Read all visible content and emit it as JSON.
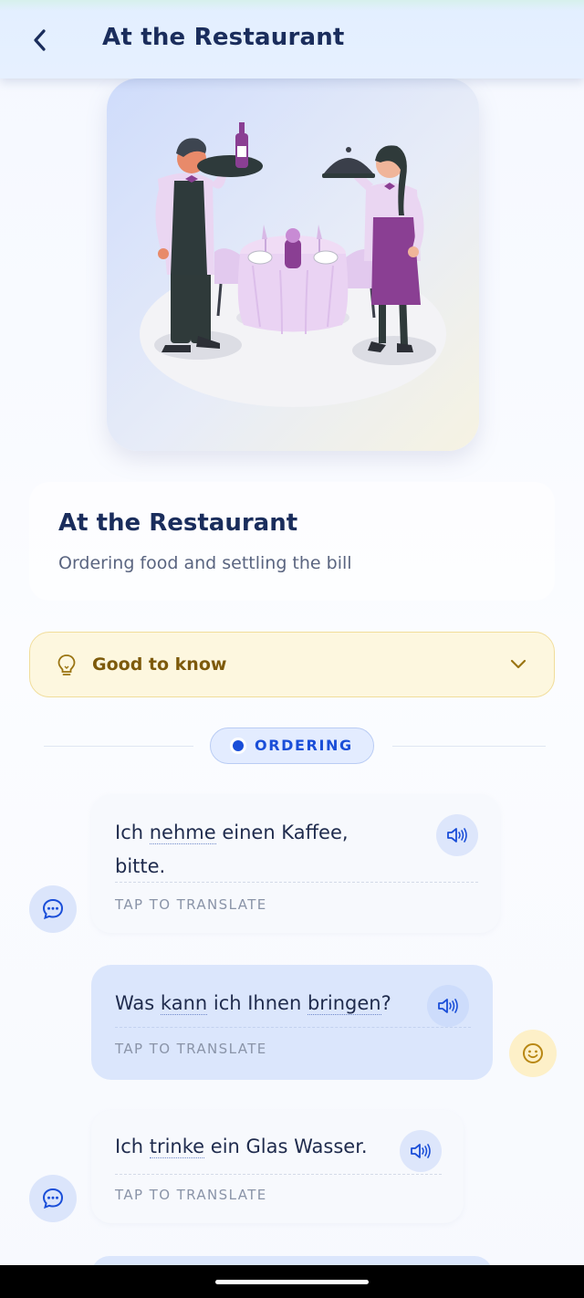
{
  "header": {
    "title": "At the Restaurant",
    "back_icon": "chevron-left-icon"
  },
  "topic": {
    "title": "At the Restaurant",
    "subtitle": "Ordering food and settling the bill"
  },
  "good_to_know": {
    "label": "Good to know",
    "icon": "lightbulb-icon",
    "chevron": "chevron-down-icon"
  },
  "section": {
    "label": "ORDERING"
  },
  "messages": [
    {
      "speaker": "left",
      "line1_pre": "Ich ",
      "line1_u": "nehme",
      "line1_post": " einen Kaffee,",
      "line2": "bitte.",
      "tap": "TAP TO TRANSLATE"
    },
    {
      "speaker": "right",
      "pre": "Was ",
      "u1": "kann",
      "mid": " ich Ihnen ",
      "u2": "bringen",
      "post": "?",
      "tap": "TAP TO TRANSLATE"
    },
    {
      "speaker": "left",
      "pre": "Ich ",
      "u1": "trinke",
      "post": " ein Glas Wasser.",
      "tap": "TAP TO TRANSLATE"
    }
  ],
  "colors": {
    "accent": "#1a4ed8",
    "title": "#1a2d5c",
    "gtk_bg": "#fdf7df",
    "gtk_text": "#7d5a0b"
  }
}
